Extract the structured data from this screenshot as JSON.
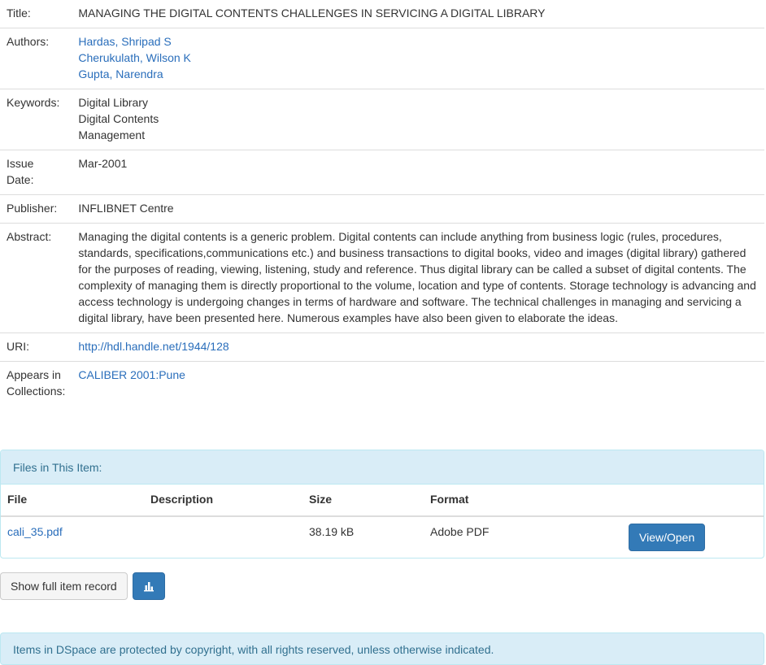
{
  "metadata": {
    "title": {
      "label": "Title:",
      "value": "MANAGING THE DIGITAL CONTENTS CHALLENGES IN SERVICING A DIGITAL LIBRARY"
    },
    "authors": {
      "label": "Authors:",
      "items": [
        "Hardas, Shripad S",
        "Cherukulath, Wilson K",
        "Gupta, Narendra"
      ]
    },
    "keywords": {
      "label": "Keywords:",
      "items": [
        "Digital Library",
        "Digital Contents",
        "Management"
      ]
    },
    "issue_date": {
      "label_line1": "Issue",
      "label_line2": "Date:",
      "value": "Mar-2001"
    },
    "publisher": {
      "label": "Publisher:",
      "value": "INFLIBNET Centre"
    },
    "abstract": {
      "label": "Abstract:",
      "value": "Managing the digital contents is a generic problem. Digital contents can include anything from business logic (rules, procedures, standards, specifications,communications etc.) and business transactions to digital books, video and images (digital library) gathered for the purposes of reading, viewing, listening, study and reference. Thus digital library can be called a subset of digital contents. The complexity of managing them is directly proportional to the volume, location and type of contents. Storage technology is advancing and access technology is undergoing changes in terms of hardware and software. The technical challenges in managing and servicing a digital library, have been presented here. Numerous examples have also been given to elaborate the ideas."
    },
    "uri": {
      "label": "URI:",
      "value": "http://hdl.handle.net/1944/128"
    },
    "collections": {
      "label_line1": "Appears in",
      "label_line2": "Collections:",
      "value": "CALIBER 2001:Pune"
    }
  },
  "files_panel": {
    "heading": "Files in This Item:",
    "columns": [
      "File",
      "Description",
      "Size",
      "Format"
    ],
    "rows": [
      {
        "file": "cali_35.pdf",
        "description": "",
        "size": "38.19 kB",
        "format": "Adobe PDF",
        "action": "View/Open"
      }
    ]
  },
  "actions": {
    "full_record_label": "Show full item record",
    "stats_icon": "bar-chart-icon"
  },
  "notice": {
    "text": "Items in DSpace are protected by copyright, with all rights reserved, unless otherwise indicated."
  }
}
